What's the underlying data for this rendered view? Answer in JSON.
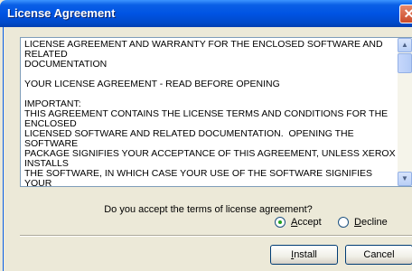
{
  "window": {
    "title": "License Agreement",
    "close_glyph": "✕"
  },
  "license": {
    "text": "LICENSE AGREEMENT AND WARRANTY FOR THE ENCLOSED SOFTWARE AND RELATED\nDOCUMENTATION\n\nYOUR LICENSE AGREEMENT - READ BEFORE OPENING\n\nIMPORTANT:\nTHIS AGREEMENT CONTAINS THE LICENSE TERMS AND CONDITIONS FOR THE ENCLOSED\nLICENSED SOFTWARE AND RELATED DOCUMENTATION.  OPENING THE SOFTWARE\nPACKAGE SIGNIFIES YOUR ACCEPTANCE OF THIS AGREEMENT, UNLESS XEROX INSTALLS\nTHE SOFTWARE, IN WHICH CASE YOUR USE OF THE SOFTWARE SIGNIFIES YOUR\nACCEPTANCE.  IF YOU DO NOT ACCEPT THIS AGREEMENT, YOU MUST RETURN THE\nSOFTWARE PACKAGE UNUSED.  IF XEROX INSTALLS THE SOFTWARE, YOU MUST\nRETURN THE SOFTWARE PACKAGE AND DELETE ANY SOFTWARE FILES ACCESSED BY\nYOU FROM ANY AND ALL COMPUTER MEMORY INTO WHICH SUCH SOFTWARE HAS BEEN"
  },
  "scrollbar": {
    "up_glyph": "▲",
    "down_glyph": "▼"
  },
  "question": "Do you accept the terms of license agreement?",
  "options": {
    "accept": {
      "mnemonic": "A",
      "rest": "ccept",
      "selected": true
    },
    "decline": {
      "mnemonic": "D",
      "rest": "ecline",
      "selected": false
    }
  },
  "buttons": {
    "install": {
      "mnemonic": "I",
      "rest": "nstall"
    },
    "cancel": "Cancel"
  }
}
